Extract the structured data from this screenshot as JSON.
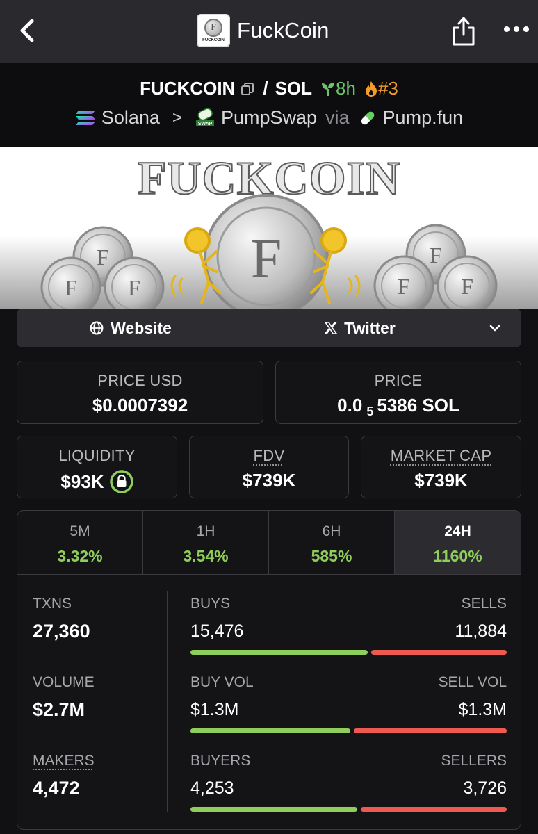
{
  "app": {
    "title": "FuckCoin",
    "logo_text": "FUCKCOIN",
    "logo_letter": "F"
  },
  "pair": {
    "base": "FUCKCOIN",
    "slash": "/",
    "quote": "SOL",
    "age": "8h",
    "rank": "#3",
    "chain": "Solana",
    "dex": "PumpSwap",
    "dex_icon_text": "SWAP",
    "via": "via",
    "launchpad": "Pump.fun",
    "chevron": ">"
  },
  "banner": {
    "title": "FUCKCOIN",
    "coin_letter": "F"
  },
  "links": {
    "website": "Website",
    "twitter": "Twitter"
  },
  "price": {
    "usd_label": "PRICE USD",
    "usd_value": "$0.0007392",
    "native_label": "PRICE",
    "native_prefix": "0.0",
    "native_subscript": "5",
    "native_digits": "5386 SOL"
  },
  "metrics": {
    "liquidity_label": "LIQUIDITY",
    "liquidity_value": "$93K",
    "fdv_label": "FDV",
    "fdv_value": "$739K",
    "mcap_label": "MARKET CAP",
    "mcap_value": "$739K"
  },
  "timeframes": [
    {
      "label": "5M",
      "value": "3.32%"
    },
    {
      "label": "1H",
      "value": "3.54%"
    },
    {
      "label": "6H",
      "value": "585%"
    },
    {
      "label": "24H",
      "value": "1160%",
      "active": true
    }
  ],
  "stats": {
    "txns_label": "TXNS",
    "txns_value": "27,360",
    "volume_label": "VOLUME",
    "volume_value": "$2.7M",
    "makers_label": "MAKERS",
    "makers_value": "4,472",
    "buys_label": "BUYS",
    "buys_value": "15,476",
    "sells_label": "SELLS",
    "sells_value": "11,884",
    "buys_fraction": 0.566,
    "buy_vol_label": "BUY VOL",
    "buy_vol_value": "$1.3M",
    "sell_vol_label": "SELL VOL",
    "sell_vol_value": "$1.3M",
    "buy_vol_fraction": 0.51,
    "buyers_label": "BUYERS",
    "buyers_value": "4,253",
    "sellers_label": "SELLERS",
    "sellers_value": "3,726",
    "buyers_fraction": 0.533
  },
  "colors": {
    "positive": "#8fce5a",
    "negative": "#ee5a52",
    "age": "#6cc36a",
    "rank": "#f39c2a"
  },
  "icons": [
    "back-arrow-icon",
    "share-icon",
    "more-icon",
    "copy-icon",
    "seedling-icon",
    "flame-icon",
    "solana-icon",
    "pumpswap-icon",
    "pill-icon",
    "globe-icon",
    "x-icon",
    "chevron-down-icon",
    "lock-icon"
  ]
}
